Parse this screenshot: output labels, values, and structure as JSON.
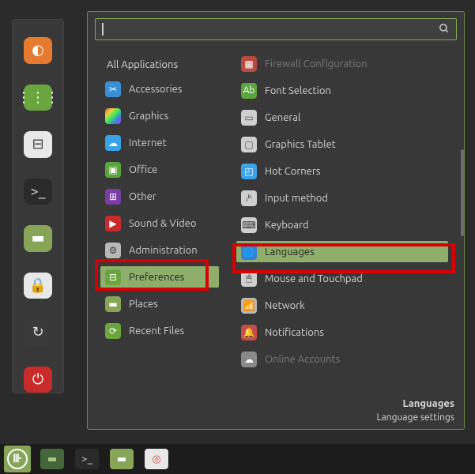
{
  "launcher": [
    {
      "name": "firefox-icon",
      "bg": "#e67a2e",
      "glyph": "◐"
    },
    {
      "name": "apps-grid-icon",
      "bg": "#6aa63d",
      "glyph": "⋮⋮⋮"
    },
    {
      "name": "control-icon",
      "bg": "#e8e8e8",
      "glyph": "⊟",
      "color": "#444"
    },
    {
      "name": "terminal-icon",
      "bg": "#2a2a2a",
      "glyph": ">_",
      "color": "#ddd"
    },
    {
      "name": "files-icon",
      "bg": "#87a556",
      "glyph": "▬"
    },
    {
      "name": "lock-icon",
      "bg": "#e8e8e8",
      "glyph": "🔒",
      "color": "#333"
    },
    {
      "name": "logout-icon",
      "bg": "#3a3a3a",
      "glyph": "↻",
      "color": "#ddd"
    },
    {
      "name": "shutdown-icon",
      "bg": "#c92a2a",
      "glyph": "⏻"
    }
  ],
  "search": {
    "value": "",
    "placeholder": ""
  },
  "header": {
    "allApps": "All Applications"
  },
  "categories": [
    {
      "name": "accessories",
      "label": "Accessories",
      "icon_bg": "#3a90d6",
      "glyph": "✂"
    },
    {
      "name": "graphics",
      "label": "Graphics",
      "icon_bg": "linear-gradient(135deg,#e83e3e,#e8d23e,#3ee85a,#3e7ee8,#b83ee8)",
      "glyph": ""
    },
    {
      "name": "internet",
      "label": "Internet",
      "icon_bg": "#3aa3e8",
      "glyph": "☁"
    },
    {
      "name": "office",
      "label": "Office",
      "icon_bg": "#5aa63d",
      "glyph": "▣"
    },
    {
      "name": "other",
      "label": "Other",
      "icon_bg": "#7a3da6",
      "glyph": "⊞"
    },
    {
      "name": "sound-video",
      "label": "Sound & Video",
      "icon_bg": "#c92a2a",
      "glyph": "▶"
    },
    {
      "name": "administration",
      "label": "Administration",
      "icon_bg": "#b8b8b8",
      "glyph": "⚙",
      "color": "#444"
    },
    {
      "name": "preferences",
      "label": "Preferences",
      "icon_bg": "#6aa63d",
      "glyph": "⊟",
      "selected": true
    },
    {
      "name": "places",
      "label": "Places",
      "icon_bg": "#87a556",
      "glyph": "▬"
    },
    {
      "name": "recent-files",
      "label": "Recent Files",
      "icon_bg": "#6aa63d",
      "glyph": "⟳"
    }
  ],
  "apps": [
    {
      "name": "firewall-configuration",
      "label": "Firewall Configuration",
      "icon_bg": "#b84a3e",
      "glyph": "▦",
      "dim": true
    },
    {
      "name": "font-selection",
      "label": "Font Selection",
      "icon_bg": "#5aa63d",
      "glyph": "Ab"
    },
    {
      "name": "general",
      "label": "General",
      "icon_bg": "#cfcfcf",
      "glyph": "▭",
      "color": "#555"
    },
    {
      "name": "graphics-tablet",
      "label": "Graphics Tablet",
      "icon_bg": "#cfcfcf",
      "glyph": "▢",
      "color": "#555"
    },
    {
      "name": "hot-corners",
      "label": "Hot Corners",
      "icon_bg": "#3aa3e8",
      "glyph": "◰"
    },
    {
      "name": "input-method",
      "label": "Input method",
      "icon_bg": "#cfcfcf",
      "glyph": "ᵢᵇ",
      "color": "#333"
    },
    {
      "name": "keyboard",
      "label": "Keyboard",
      "icon_bg": "#cfcfcf",
      "glyph": "⌨",
      "color": "#333"
    },
    {
      "name": "languages",
      "label": "Languages",
      "icon_bg": "#3a7fd6",
      "glyph": "🌐",
      "selected": true
    },
    {
      "name": "mouse-touchpad",
      "label": "Mouse and Touchpad",
      "icon_bg": "#cfcfcf",
      "glyph": "🖱",
      "color": "#333"
    },
    {
      "name": "network",
      "label": "Network",
      "icon_bg": "#b8b8b8",
      "glyph": "📶",
      "color": "#333"
    },
    {
      "name": "notifications",
      "label": "Notifications",
      "icon_bg": "#c94a4a",
      "glyph": "🔔"
    },
    {
      "name": "online-accounts",
      "label": "Online Accounts",
      "icon_bg": "#8a8a8a",
      "glyph": "☁",
      "dim": true
    }
  ],
  "tooltip": {
    "title": "Languages",
    "subtitle": "Language settings"
  },
  "panel": [
    {
      "name": "files-launcher",
      "bg": "#44663a",
      "glyph": "▬",
      "color": "#a8c985"
    },
    {
      "name": "terminal-launcher",
      "bg": "#2a2a2a",
      "glyph": ">_",
      "color": "#ddd"
    },
    {
      "name": "files2-launcher",
      "bg": "#87a556",
      "glyph": "▬"
    },
    {
      "name": "chrome-launcher",
      "bg": "#e8e8e8",
      "glyph": "◎",
      "color": "#d84a3e"
    }
  ]
}
